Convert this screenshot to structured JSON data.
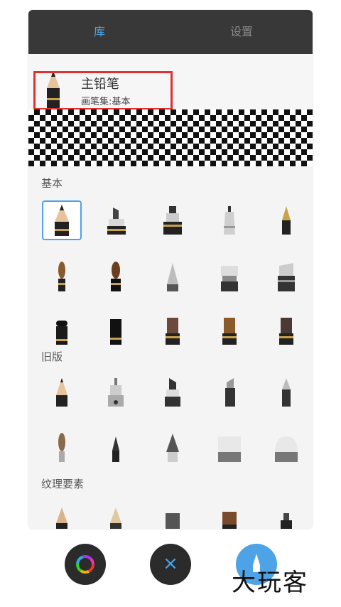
{
  "tabs": {
    "library": "库",
    "settings": "设置"
  },
  "current_brush": {
    "name": "主铅笔",
    "set": "画笔集:基本"
  },
  "sections": [
    {
      "title": "基本"
    },
    {
      "title": "旧版"
    },
    {
      "title": "纹理要素"
    }
  ],
  "brush_names": {
    "basic": [
      "pencil",
      "marker-chisel",
      "marker-wide",
      "ballpoint-pen",
      "fountain-nib",
      "round-brush",
      "ink-brush",
      "airbrush",
      "paint-roller",
      "wide-marker",
      "flat-brush-small",
      "flat-brush-black",
      "bristle-brush",
      "dry-brush",
      "flat-paint-brush"
    ],
    "legacy": [
      "pencil",
      "technical-pen",
      "chisel-marker",
      "felt-tip",
      "ballpoint",
      "fine-brush",
      "small-brush",
      "dip-pen",
      "eraser-hard",
      "eraser-soft"
    ],
    "texture": [
      "pencil-texture",
      "charcoal",
      "block",
      "bristle",
      "fine-tip"
    ]
  },
  "bottom_bar": {
    "color_button": "color-wheel",
    "close_button": "×",
    "brush_button": "brush"
  },
  "watermark": "大玩客",
  "colors": {
    "accent": "#4da3e6",
    "tab_bar": "#383838",
    "highlight": "#e03030"
  }
}
